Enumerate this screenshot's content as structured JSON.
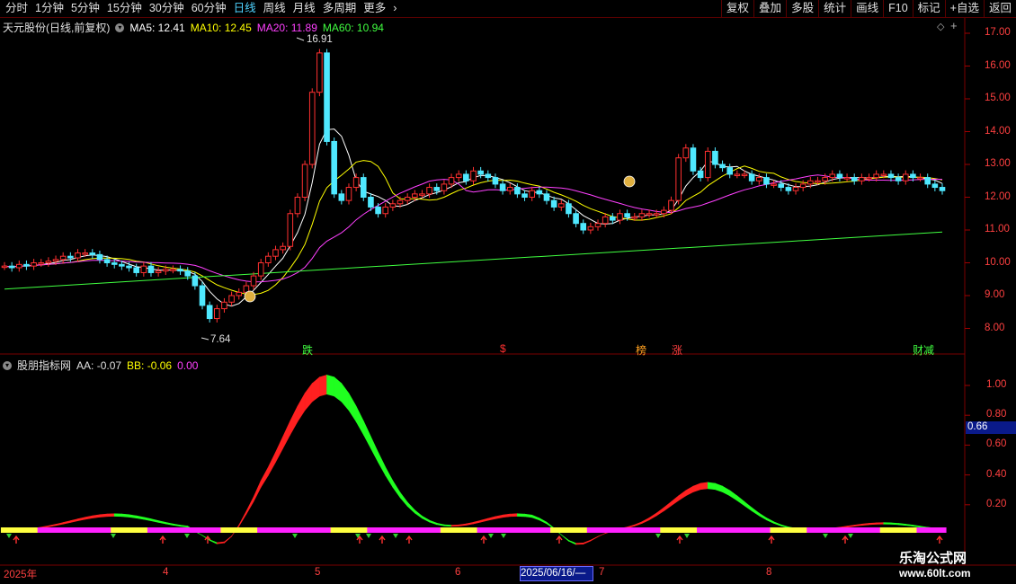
{
  "toolbar": {
    "tabs": [
      "分时",
      "1分钟",
      "5分钟",
      "15分钟",
      "30分钟",
      "60分钟",
      "日线",
      "周线",
      "月线",
      "多周期",
      "更多"
    ],
    "active_tab": "日线",
    "more_arrow": "›",
    "buttons": [
      "复权",
      "叠加",
      "多股",
      "统计",
      "画线",
      "F10",
      "标记",
      "+自选",
      "返回"
    ]
  },
  "main_chart": {
    "title": "天元股份(日线,前复权)",
    "ma": [
      {
        "label": "MA5: 12.41",
        "color": "#ffffff"
      },
      {
        "label": "MA10: 12.45",
        "color": "#ffff00"
      },
      {
        "label": "MA20: 11.89",
        "color": "#ff40ff"
      },
      {
        "label": "MA60: 10.94",
        "color": "#40ff40"
      }
    ],
    "price_axis": [
      "17.00",
      "16.00",
      "15.00",
      "14.00",
      "13.00",
      "12.00",
      "11.00",
      "10.00",
      "9.00",
      "8.00"
    ],
    "high_annotation": "16.91",
    "low_annotation": "7.64",
    "markers": [
      {
        "text": "跌",
        "color": "#40ff40"
      },
      {
        "text": "$",
        "color": "#ff3030"
      },
      {
        "text": "榜",
        "color": "#ffa020"
      },
      {
        "text": "涨",
        "color": "#ff4040"
      },
      {
        "text": "财减",
        "color": "#40ff40"
      }
    ]
  },
  "indicator": {
    "title": "股朋指标网",
    "aa": "AA: -0.07",
    "bb": "BB: -0.06",
    "cc": "0.00",
    "axis": [
      "1.00",
      "0.80",
      "0.60",
      "0.40",
      "0.20"
    ],
    "current_value": "0.66"
  },
  "date_axis": {
    "labels": [
      "2025年",
      "4",
      "5",
      "6",
      "7",
      "8"
    ],
    "cursor_date": "2025/06/16/—"
  },
  "watermark": {
    "line1": "乐淘公式网",
    "line2": "www.60lt.com"
  },
  "colors": {
    "up": "#ff3030",
    "down": "#4fe8ff",
    "ma5": "#ffffff",
    "ma10": "#ffff00",
    "ma20": "#ff40ff",
    "ma60": "#40ff40"
  }
}
